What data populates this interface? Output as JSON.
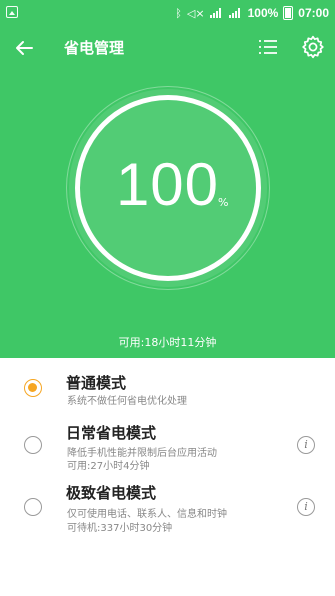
{
  "status_bar": {
    "battery_percent": "100%",
    "time": "07:00",
    "icons": [
      "image-icon",
      "bluetooth-icon",
      "mute-icon",
      "4g-signal-icon",
      "cell-signal-icon",
      "battery-icon"
    ]
  },
  "app_bar": {
    "title": "省电管理",
    "icons": [
      "back-arrow-icon",
      "list-icon",
      "gear-icon"
    ]
  },
  "battery": {
    "level": "100",
    "unit": "%",
    "available": "可用:18小时11分钟"
  },
  "colors": {
    "hero_bg": "#3fc766",
    "accent_selected": "#f6a623",
    "text_primary": "#222222",
    "text_secondary": "#888888"
  },
  "modes": [
    {
      "name": "普通模式",
      "desc1": "系统不做任何省电优化处理",
      "desc2": "",
      "selected": true,
      "has_info": false
    },
    {
      "name": "日常省电模式",
      "desc1": "降低手机性能并限制后台应用活动",
      "desc2": "可用:27小时4分钟",
      "selected": false,
      "has_info": true
    },
    {
      "name": "极致省电模式",
      "desc1": "仅可使用电话、联系人、信息和时钟",
      "desc2": "可待机:337小时30分钟",
      "selected": false,
      "has_info": true
    }
  ]
}
